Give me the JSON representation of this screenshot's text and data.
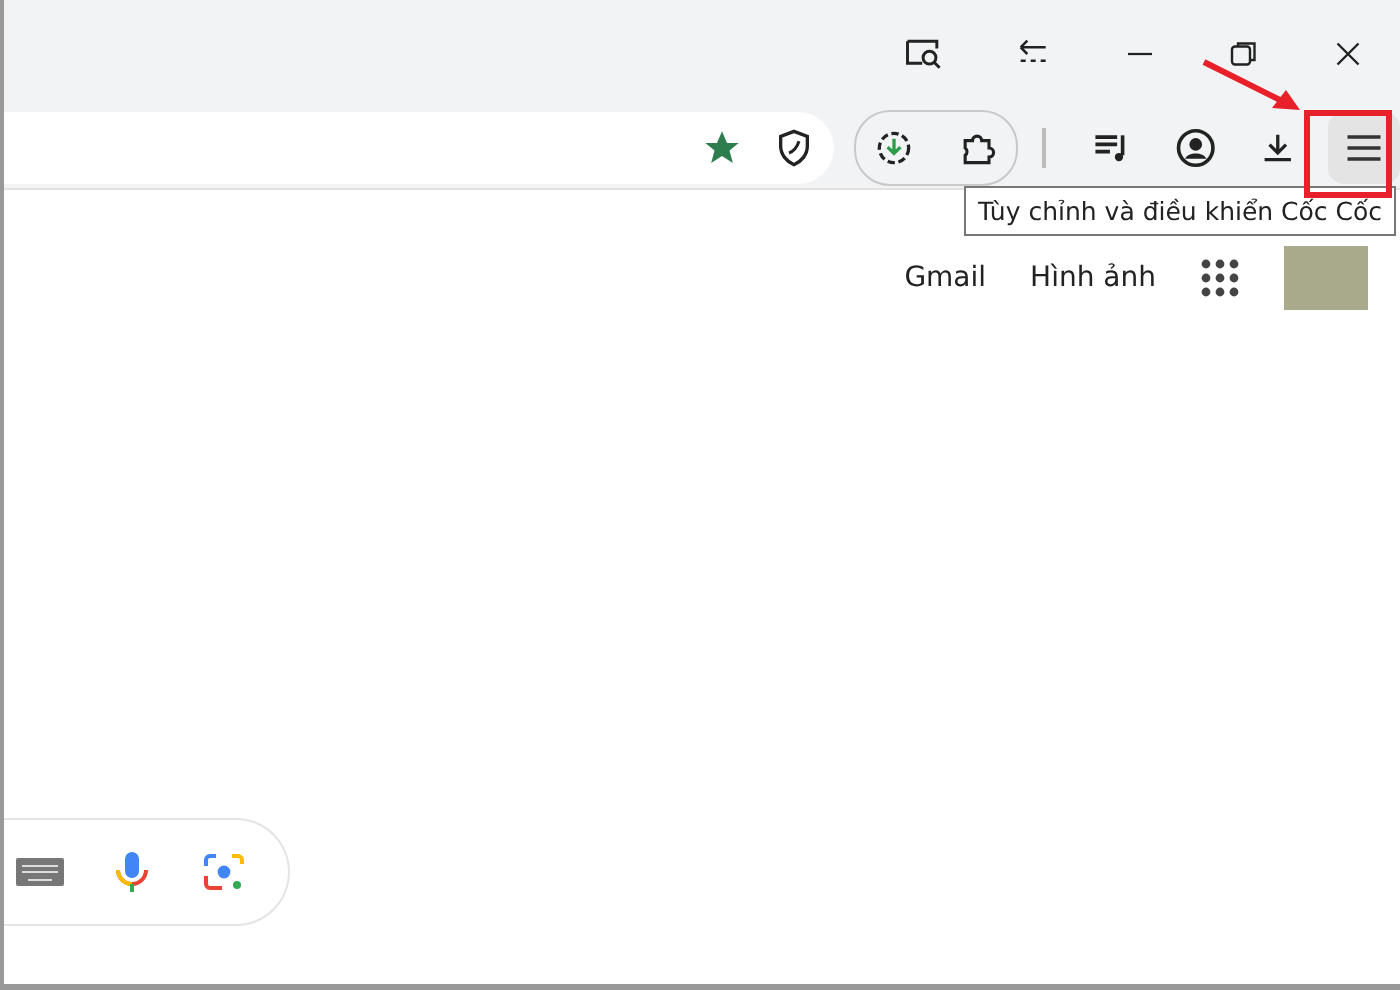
{
  "tooltip": {
    "text": "Tùy chỉnh và điều khiển Cốc Cốc"
  },
  "page_links": [
    {
      "label": "Gmail"
    },
    {
      "label": "Hình ảnh"
    }
  ],
  "annotation": {
    "color": "#e8202a"
  }
}
